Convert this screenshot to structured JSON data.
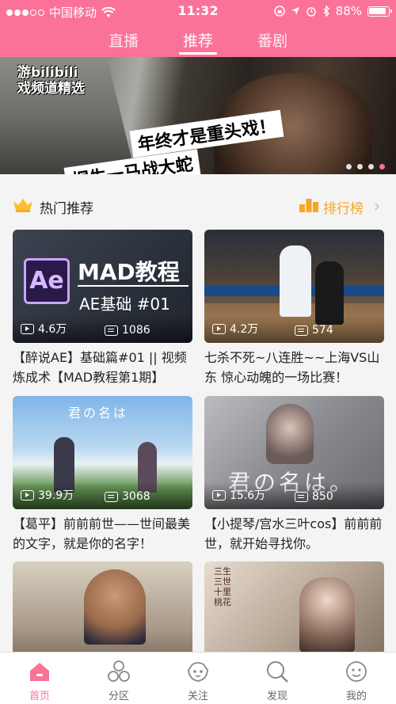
{
  "status_bar": {
    "carrier": "中国移动",
    "time": "11:32",
    "battery": "88%"
  },
  "top_tabs": [
    {
      "label": "直播",
      "active": false
    },
    {
      "label": "推荐",
      "active": true
    },
    {
      "label": "番剧",
      "active": false
    }
  ],
  "banner": {
    "logo_line1": "游bilibili",
    "logo_line2": "戏频道精选",
    "slogan_main": "年终才是重头戏！",
    "slogan_sub": "桐生一马战大蛇",
    "page_count": 4,
    "active_page": 4
  },
  "section": {
    "title": "热门推荐",
    "rank_label": "排行榜"
  },
  "cards": [
    {
      "views": "4.6万",
      "danmaku": "1086",
      "title": "【醉说AE】基础篇#01 || 视频炼成术【MAD教程第1期】",
      "art_big": "MAD教程",
      "art_small": "AE基础  #01",
      "art_logo": "Ae"
    },
    {
      "views": "4.2万",
      "danmaku": "574",
      "title": "七杀不死~八连胜~~上海VS山东  惊心动魄的一场比赛！"
    },
    {
      "views": "39.9万",
      "danmaku": "3068",
      "title": "【葛平】前前前世——世间最美的文字，就是你的名字！",
      "art_text": "君の名は"
    },
    {
      "views": "15.6万",
      "danmaku": "850",
      "title": "【小提琴/宫水三叶cos】前前前世，就开始寻找你。",
      "art_text": "君の名は。"
    },
    {
      "views": "",
      "danmaku": "",
      "title": ""
    },
    {
      "views": "",
      "danmaku": "",
      "title": "",
      "art_text": "三生三世十里桃花"
    }
  ],
  "bottom_tabs": [
    {
      "label": "首页",
      "icon": "home-icon",
      "active": true
    },
    {
      "label": "分区",
      "icon": "category-icon",
      "active": false
    },
    {
      "label": "关注",
      "icon": "follow-icon",
      "active": false
    },
    {
      "label": "发现",
      "icon": "search-icon",
      "active": false
    },
    {
      "label": "我的",
      "icon": "profile-icon",
      "active": false
    }
  ],
  "colors": {
    "brand_pink": "#fb7299",
    "rank_orange": "#f5a623"
  }
}
